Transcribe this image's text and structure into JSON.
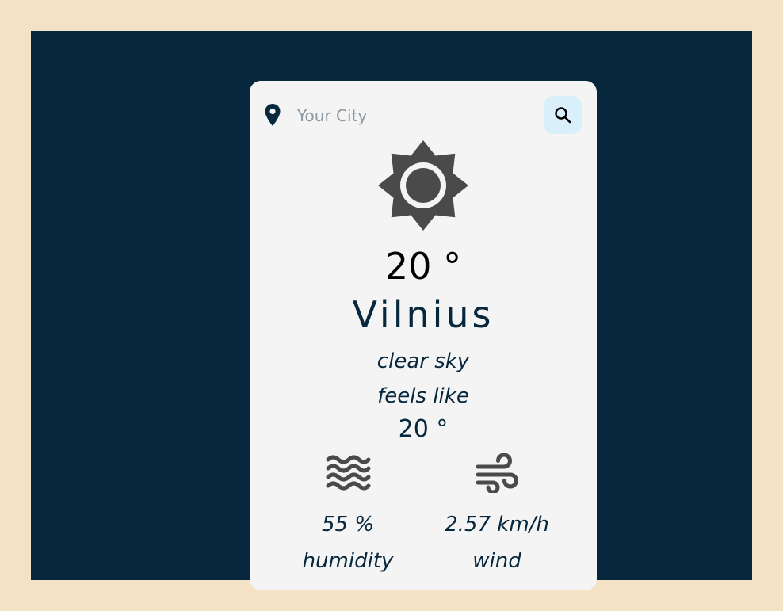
{
  "search": {
    "placeholder": "Your City",
    "value": "",
    "button_icon": "search-icon",
    "location_icon": "map-pin-icon"
  },
  "weather": {
    "icon": "sun-icon",
    "temperature": "20 °",
    "city": "Vilnius",
    "description": "clear sky",
    "feels_like_label": "feels like",
    "feels_like_value": "20 °"
  },
  "stats": {
    "humidity": {
      "icon": "waves-icon",
      "value": "55 %",
      "label": "humidity"
    },
    "wind": {
      "icon": "wind-icon",
      "value": "2.57 km/h",
      "label": "wind"
    }
  },
  "colors": {
    "page_background": "#f3e2c5",
    "stage_background": "#07273c",
    "card_background": "#f4f4f5",
    "search_button_background": "#d9f0fb",
    "text_primary": "#07273c",
    "icon_gray": "#4a4a4a"
  }
}
